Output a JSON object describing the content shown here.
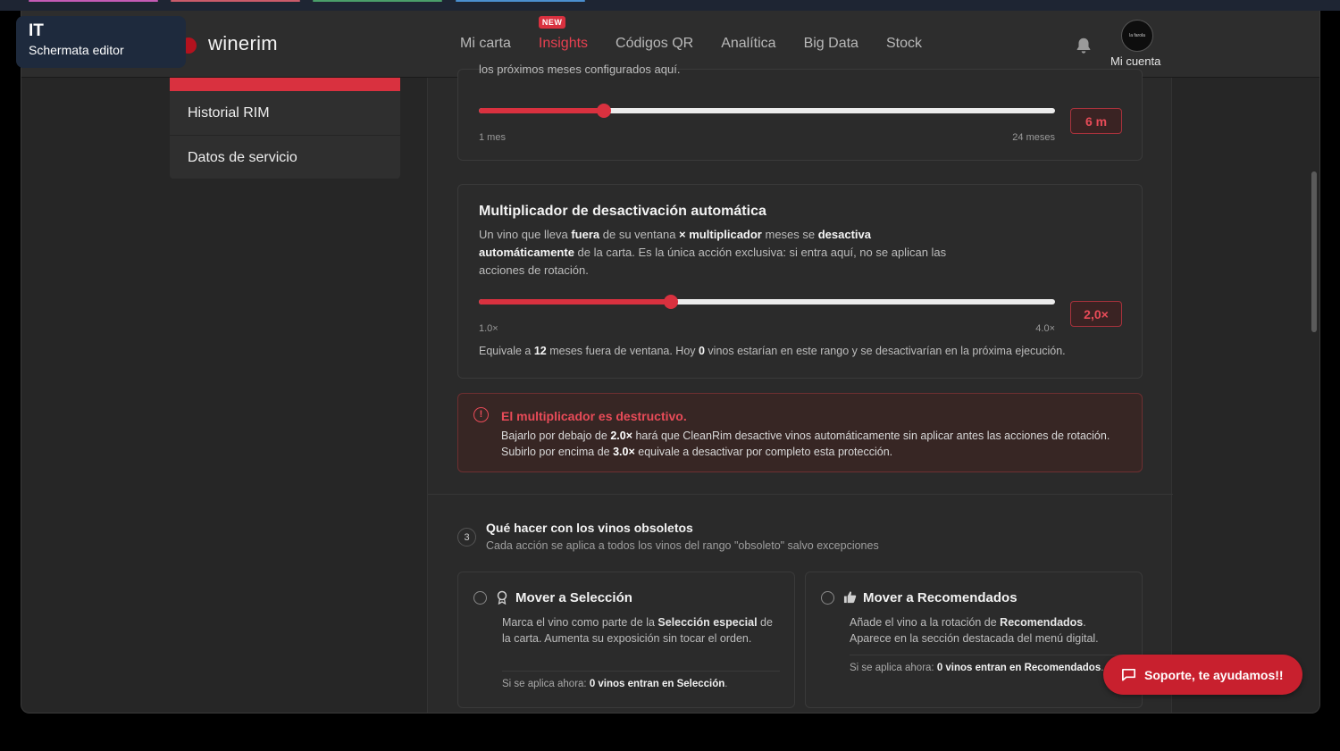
{
  "overlay": {
    "lang_code": "IT",
    "caption": "Schermata editor"
  },
  "brand": {
    "name": "winerim",
    "accent": "#d9313f"
  },
  "nav": {
    "items": [
      {
        "label": "Mi carta"
      },
      {
        "label": "Insights",
        "badge": "NEW",
        "active": true
      },
      {
        "label": "Códigos QR"
      },
      {
        "label": "Analítica"
      },
      {
        "label": "Big Data"
      },
      {
        "label": "Stock"
      }
    ],
    "bell_icon": "bell-icon",
    "avatar_text": "la farola",
    "account_label": "Mi cuenta"
  },
  "sidebar": {
    "items": [
      {
        "label": "Historial RIM"
      },
      {
        "label": "Datos de servicio"
      }
    ]
  },
  "months_slider": {
    "cut_text": "los próximos meses configurados aquí.",
    "min_label": "1 mes",
    "max_label": "24 meses",
    "min": 1,
    "max": 24,
    "value": 6,
    "value_label": "6 m"
  },
  "multiplier": {
    "title": "Multiplicador de desactivación automática",
    "desc_1": "Un vino que lleva ",
    "desc_b1": "fuera",
    "desc_2": " de su ventana ",
    "desc_b2": "× multiplicador",
    "desc_3": " meses se ",
    "desc_b3": "desactiva automáticamente",
    "desc_4": " de la carta. Es la única acción exclusiva: si entra aquí, no se aplican las acciones de rotación.",
    "min_label": "1.0×",
    "max_label": "4.0×",
    "min": 1.0,
    "max": 4.0,
    "value": 2.0,
    "value_label": "2,0×",
    "equiv_1": "Equivale a ",
    "equiv_b1": "12",
    "equiv_2": " meses fuera de ventana. Hoy ",
    "equiv_b2": "0",
    "equiv_3": " vinos estarían en este rango y se desactivarían en la próxima ejecución."
  },
  "alert": {
    "icon": "alert-circle-icon",
    "title": "El multiplicador es destructivo.",
    "text_1": "Bajarlo por debajo de ",
    "text_b1": "2.0×",
    "text_2": " hará que CleanRim desactive vinos automáticamente sin aplicar antes las acciones de rotación. Subirlo por encima de ",
    "text_b2": "3.0×",
    "text_3": " equivale a desactivar por completo esta protección."
  },
  "step3": {
    "number": "3",
    "title": "Qué hacer con los vinos obsoletos",
    "subtitle": "Cada acción se aplica a todos los vinos del rango \"obsoleto\" salvo excepciones"
  },
  "options": [
    {
      "icon": "award-icon",
      "title": "Mover a Selección",
      "desc_1": "Marca el vino como parte de la ",
      "desc_b": "Selección especial",
      "desc_2": " de la carta. Aumenta su exposición sin tocar el orden.",
      "foot_1": "Si se aplica ahora: ",
      "foot_b": "0 vinos entran en Selección",
      "foot_2": "."
    },
    {
      "icon": "thumbs-up-icon",
      "title": "Mover a Recomendados",
      "desc_1": "Añade el vino a la rotación de ",
      "desc_b": "Recomendados",
      "desc_2": ". Aparece en la sección destacada del menú digital.",
      "foot_1": "Si se aplica ahora: ",
      "foot_b": "0 vinos entran en Recomendados",
      "foot_2": "."
    }
  ],
  "support": {
    "label": "Soporte, te ayudamos!!",
    "icon": "chat-icon"
  }
}
